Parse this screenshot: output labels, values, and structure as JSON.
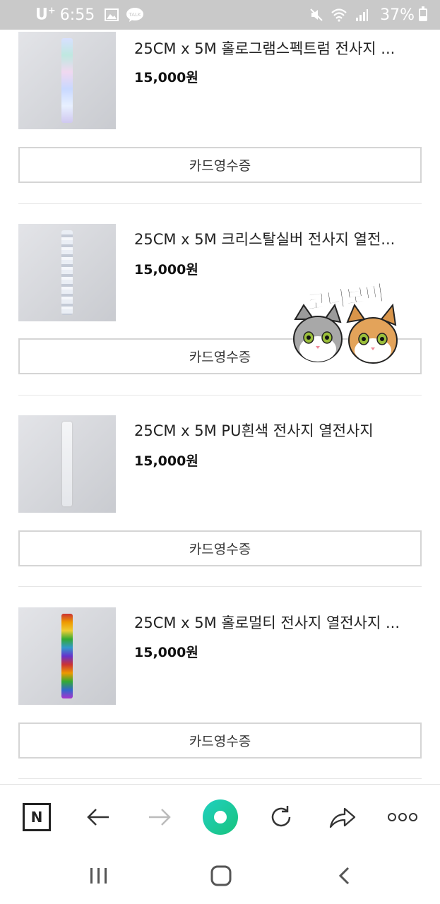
{
  "status_bar": {
    "carrier": "U",
    "carrier_sup": "+",
    "time": "6:55",
    "talk_label": "TALK",
    "battery": "37%"
  },
  "products": [
    {
      "title": "25CM x 5M 홀로그램스펙트럼 전사지 ...",
      "price": "15,000원",
      "button": "카드영수증",
      "thumb": "holo"
    },
    {
      "title": "25CM x 5M 크리스탈실버 전사지 열전...",
      "price": "15,000원",
      "button": "카드영수증",
      "thumb": "crystal"
    },
    {
      "title": "25CM x 5M PU흰색 전사지 열전사지",
      "price": "15,000원",
      "button": "카드영수증",
      "thumb": "white"
    },
    {
      "title": "25CM x 5M 홀로멀티 전사지 열전사지 ...",
      "price": "15,000원",
      "button": "카드영수증",
      "thumb": "multi"
    }
  ],
  "sticker": {
    "text": "코니보미"
  },
  "toolbar": {
    "home_letter": "N",
    "icons": [
      "naver-home-icon",
      "back-arrow-icon",
      "forward-arrow-icon",
      "green-dot-icon",
      "refresh-icon",
      "share-icon",
      "more-icon"
    ]
  },
  "colors": {
    "status_bar_bg": "#c9c9c9",
    "accent_green": "#19c37d",
    "accent_cyan": "#20d0c0"
  }
}
